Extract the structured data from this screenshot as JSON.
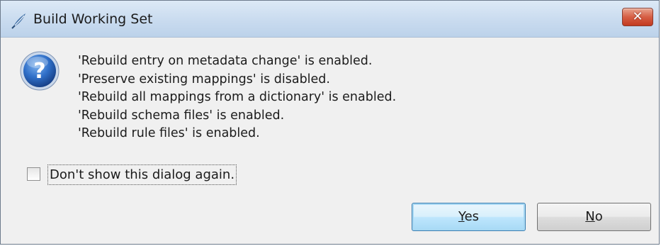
{
  "window": {
    "title": "Build Working Set",
    "close_glyph": "✕",
    "app_icon": "feather-pen-icon",
    "accent": "#c9dbef"
  },
  "message": {
    "icon": "question-icon",
    "lines": [
      "'Rebuild entry on metadata change' is enabled.",
      "'Preserve existing mappings' is disabled.",
      "'Rebuild all mappings from a dictionary' is enabled.",
      "'Rebuild schema files' is enabled.",
      "'Rebuild rule files' is enabled."
    ]
  },
  "options": {
    "dont_show_label": "Don't show this dialog again.",
    "dont_show_checked": false
  },
  "buttons": {
    "yes_mnemonic": "Y",
    "yes_rest": "es",
    "no_mnemonic": "N",
    "no_rest": "o"
  }
}
